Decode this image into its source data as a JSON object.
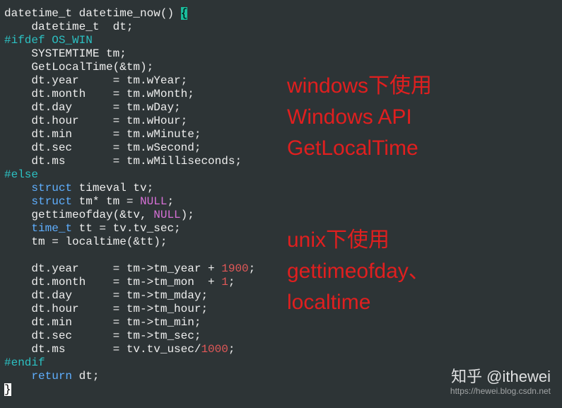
{
  "code": {
    "l1_a": "datetime_t datetime_now() ",
    "l1_b": "{",
    "l2": "    datetime_t  dt;",
    "l3": "#ifdef OS_WIN",
    "l4": "    SYSTEMTIME tm;",
    "l5": "    GetLocalTime(&tm);",
    "l6": "    dt.year     = tm.wYear;",
    "l7": "    dt.month    = tm.wMonth;",
    "l8": "    dt.day      = tm.wDay;",
    "l9": "    dt.hour     = tm.wHour;",
    "l10": "    dt.min      = tm.wMinute;",
    "l11": "    dt.sec      = tm.wSecond;",
    "l12": "    dt.ms       = tm.wMilliseconds;",
    "l13": "#else",
    "l14a": "    ",
    "l14b": "struct",
    "l14c": " timeval tv;",
    "l15a": "    ",
    "l15b": "struct",
    "l15c": " tm* tm = ",
    "l15d": "NULL",
    "l15e": ";",
    "l16a": "    gettimeofday(&tv, ",
    "l16b": "NULL",
    "l16c": ");",
    "l17a": "    ",
    "l17b": "time_t",
    "l17c": " tt = tv.tv_sec;",
    "l18": "    tm = localtime(&tt);",
    "l19": "",
    "l20a": "    dt.year     = tm->tm_year + ",
    "l20b": "1900",
    "l20c": ";",
    "l21a": "    dt.month    = tm->tm_mon  + ",
    "l21b": "1",
    "l21c": ";",
    "l22": "    dt.day      = tm->tm_mday;",
    "l23": "    dt.hour     = tm->tm_hour;",
    "l24": "    dt.min      = tm->tm_min;",
    "l25": "    dt.sec      = tm->tm_sec;",
    "l26a": "    dt.ms       = tv.tv_usec/",
    "l26b": "1000",
    "l26c": ";",
    "l27": "#endif",
    "l28a": "    ",
    "l28b": "return",
    "l28c": " dt;",
    "l29": "}"
  },
  "annotations": {
    "win": "windows下使用\nWindows API\nGetLocalTime",
    "unix": "unix下使用\ngettimeofday、\nlocaltime"
  },
  "watermark": {
    "top": "知乎 @ithewei",
    "bottom": "https://hewei.blog.csdn.net"
  }
}
